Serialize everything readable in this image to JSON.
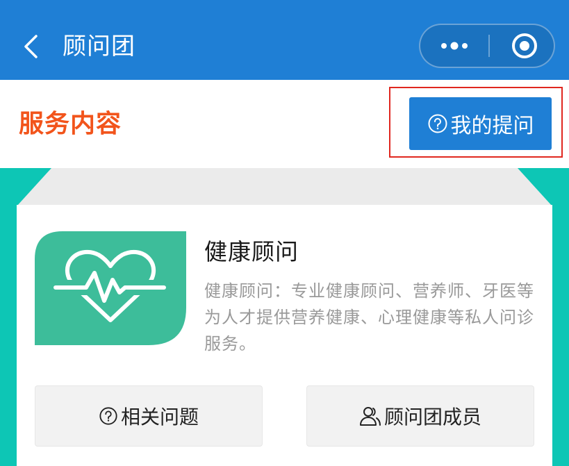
{
  "navbar": {
    "title": "顾问团",
    "back_icon": "chevron-left-icon",
    "more_icon": "more-dots-icon",
    "close_icon": "target-circle-icon",
    "background_color": "#1f7fd5"
  },
  "section": {
    "title": "服务内容",
    "title_color": "#f2541b",
    "my_question_button": {
      "label": "我的提问",
      "icon": "question-circle-icon"
    }
  },
  "card": {
    "image_icon": "heart-pulse-icon",
    "image_color": "#3dbd9a",
    "title": "健康顾问",
    "description": "健康顾问：专业健康顾问、营养师、牙医等为人才提供营养健康、心理健康等私人问诊服务。",
    "actions": [
      {
        "label": "相关问题",
        "icon": "question-circle-icon"
      },
      {
        "label": "顾问团成员",
        "icon": "users-icon"
      }
    ]
  },
  "colors": {
    "teal_background": "#0dc6b5",
    "highlight_border": "#e0271f"
  }
}
